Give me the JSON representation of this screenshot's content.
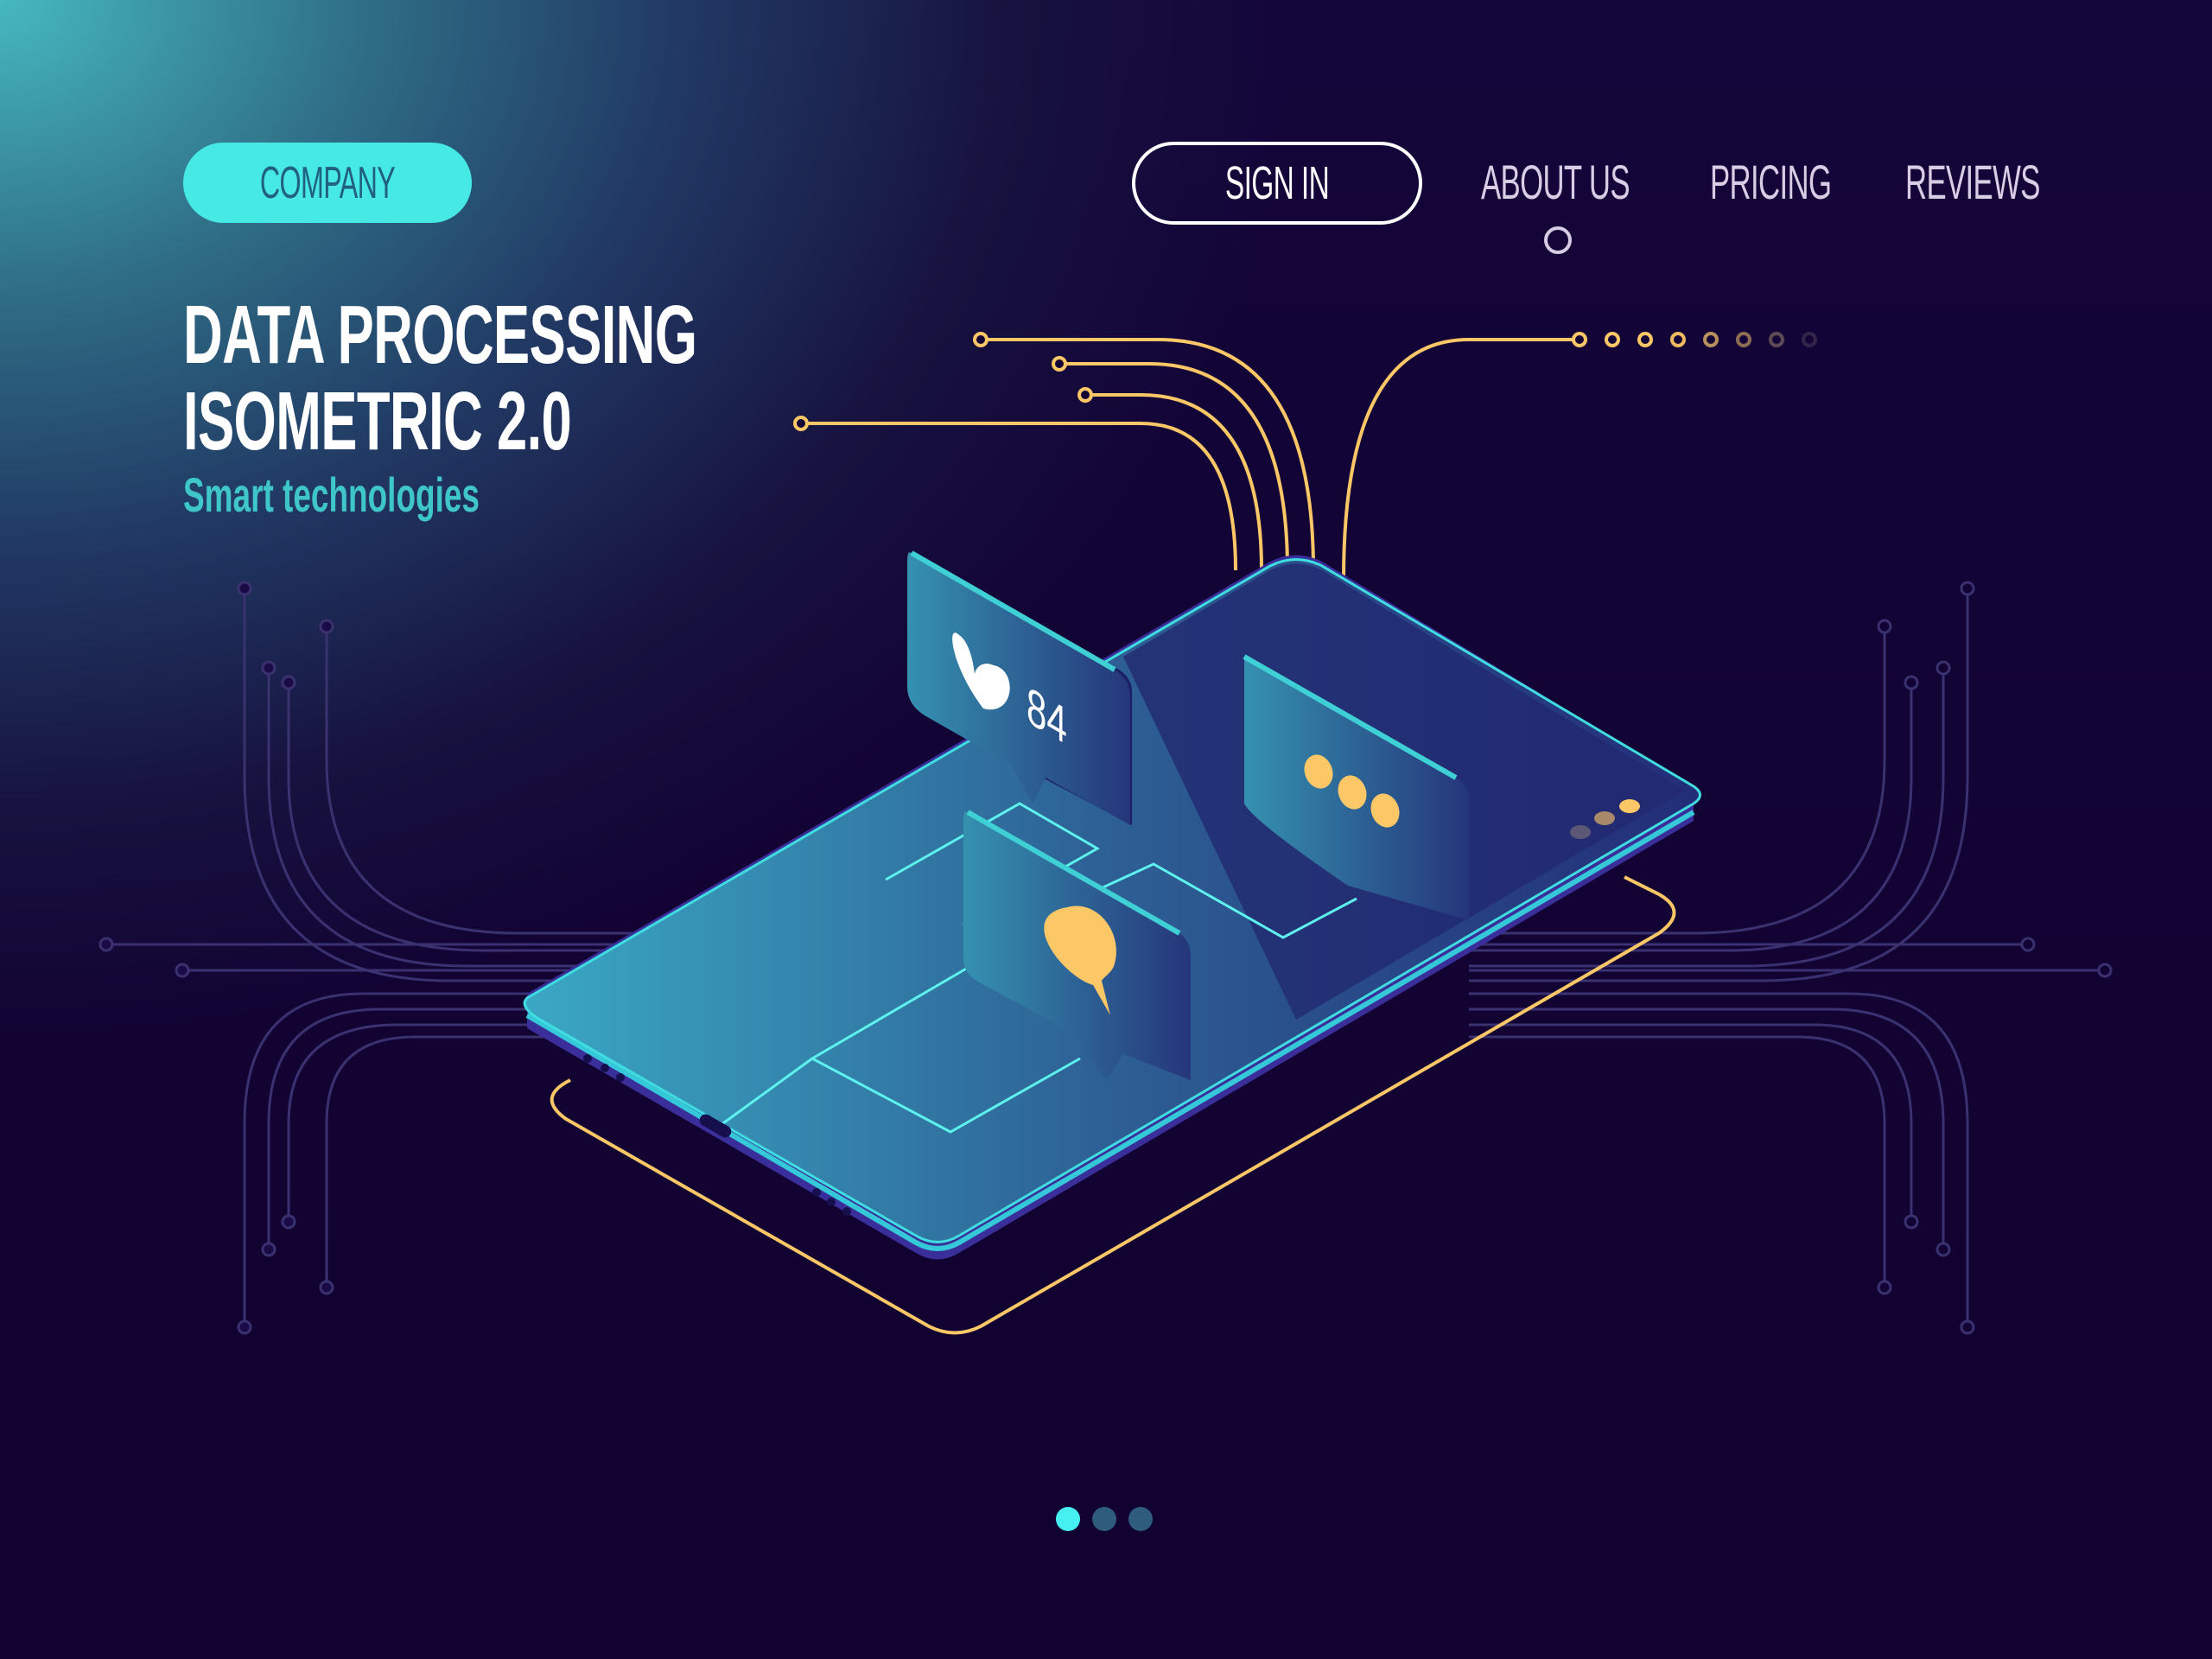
{
  "brand": {
    "label": "COMPANY"
  },
  "nav": {
    "signin_label": "SIGN IN",
    "links": [
      {
        "label": "ABOUT US",
        "active": true
      },
      {
        "label": "PRICING",
        "active": false
      },
      {
        "label": "REVIEWS",
        "active": false
      }
    ]
  },
  "hero": {
    "title_line1": "DATA PROCESSING",
    "title_line2": "ISOMETRIC 2.0",
    "subtitle": "Smart technologies"
  },
  "illustration": {
    "like_count": "84",
    "icons": [
      "heart-icon",
      "typing-dots-icon",
      "speech-bubble-icon"
    ]
  },
  "carousel": {
    "total_slides": 3,
    "active_index": 0
  },
  "colors": {
    "accent_cyan": "#46e9e3",
    "accent_gold": "#fcc766",
    "background": "#120333",
    "circuit": "#3a2f6e",
    "text_nav": "#d9cde6",
    "subtitle": "#3ec6c8"
  }
}
